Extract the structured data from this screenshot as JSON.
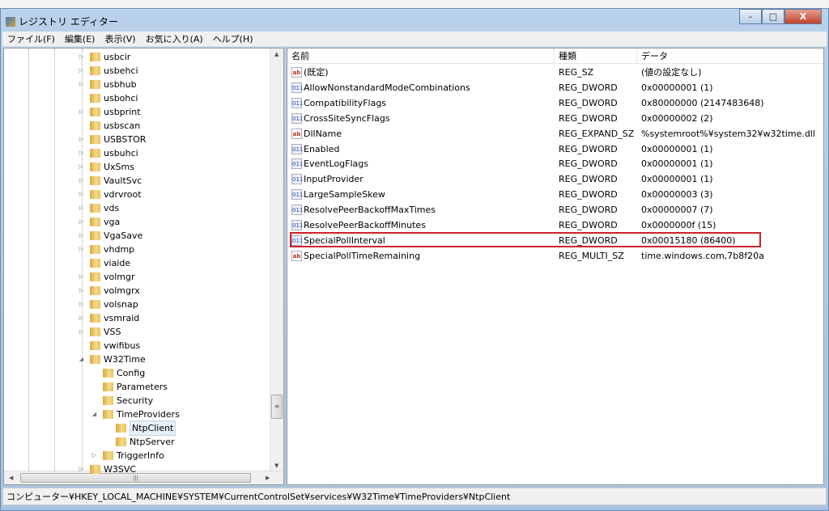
{
  "window": {
    "title": "レジストリ エディター",
    "minimize": "–",
    "maximize": "□",
    "close": "X"
  },
  "menu": [
    "ファイル(F)",
    "編集(E)",
    "表示(V)",
    "お気に入り(A)",
    "ヘルプ(H)"
  ],
  "tree": [
    {
      "label": "usbcir",
      "level": 0,
      "exp": "▷"
    },
    {
      "label": "usbehci",
      "level": 0,
      "exp": "▷"
    },
    {
      "label": "usbhub",
      "level": 0,
      "exp": "▷"
    },
    {
      "label": "usbohci",
      "level": 0,
      "exp": ""
    },
    {
      "label": "usbprint",
      "level": 0,
      "exp": "▷"
    },
    {
      "label": "usbscan",
      "level": 0,
      "exp": ""
    },
    {
      "label": "USBSTOR",
      "level": 0,
      "exp": "▷"
    },
    {
      "label": "usbuhci",
      "level": 0,
      "exp": "▷"
    },
    {
      "label": "UxSms",
      "level": 0,
      "exp": "▷"
    },
    {
      "label": "VaultSvc",
      "level": 0,
      "exp": "▷"
    },
    {
      "label": "vdrvroot",
      "level": 0,
      "exp": "▷"
    },
    {
      "label": "vds",
      "level": 0,
      "exp": "▷"
    },
    {
      "label": "vga",
      "level": 0,
      "exp": "▷"
    },
    {
      "label": "VgaSave",
      "level": 0,
      "exp": "▷"
    },
    {
      "label": "vhdmp",
      "level": 0,
      "exp": "▷"
    },
    {
      "label": "viaide",
      "level": 0,
      "exp": ""
    },
    {
      "label": "volmgr",
      "level": 0,
      "exp": "▷"
    },
    {
      "label": "volmgrx",
      "level": 0,
      "exp": "▷"
    },
    {
      "label": "volsnap",
      "level": 0,
      "exp": "▷"
    },
    {
      "label": "vsmraid",
      "level": 0,
      "exp": "▷"
    },
    {
      "label": "VSS",
      "level": 0,
      "exp": "▷"
    },
    {
      "label": "vwifibus",
      "level": 0,
      "exp": ""
    },
    {
      "label": "W32Time",
      "level": 0,
      "exp": "◢"
    },
    {
      "label": "Config",
      "level": 1,
      "exp": ""
    },
    {
      "label": "Parameters",
      "level": 1,
      "exp": ""
    },
    {
      "label": "Security",
      "level": 1,
      "exp": ""
    },
    {
      "label": "TimeProviders",
      "level": 1,
      "exp": "◢"
    },
    {
      "label": "NtpClient",
      "level": 2,
      "exp": "",
      "selected": true
    },
    {
      "label": "NtpServer",
      "level": 2,
      "exp": ""
    },
    {
      "label": "TriggerInfo",
      "level": 1,
      "exp": "▷"
    },
    {
      "label": "W3SVC",
      "level": 0,
      "exp": "▷"
    }
  ],
  "list": {
    "headers": [
      "名前",
      "種類",
      "データ"
    ],
    "rows": [
      {
        "icon": "string-value-icon",
        "name": "(既定)",
        "type": "REG_SZ",
        "data": "(値の設定なし)"
      },
      {
        "icon": "binary-value-icon",
        "name": "AllowNonstandardModeCombinations",
        "type": "REG_DWORD",
        "data": "0x00000001 (1)"
      },
      {
        "icon": "binary-value-icon",
        "name": "CompatibilityFlags",
        "type": "REG_DWORD",
        "data": "0x80000000 (2147483648)"
      },
      {
        "icon": "binary-value-icon",
        "name": "CrossSiteSyncFlags",
        "type": "REG_DWORD",
        "data": "0x00000002 (2)"
      },
      {
        "icon": "string-value-icon",
        "name": "DllName",
        "type": "REG_EXPAND_SZ",
        "data": "%systemroot%¥system32¥w32time.dll"
      },
      {
        "icon": "binary-value-icon",
        "name": "Enabled",
        "type": "REG_DWORD",
        "data": "0x00000001 (1)"
      },
      {
        "icon": "binary-value-icon",
        "name": "EventLogFlags",
        "type": "REG_DWORD",
        "data": "0x00000001 (1)"
      },
      {
        "icon": "binary-value-icon",
        "name": "InputProvider",
        "type": "REG_DWORD",
        "data": "0x00000001 (1)"
      },
      {
        "icon": "binary-value-icon",
        "name": "LargeSampleSkew",
        "type": "REG_DWORD",
        "data": "0x00000003 (3)"
      },
      {
        "icon": "binary-value-icon",
        "name": "ResolvePeerBackoffMaxTimes",
        "type": "REG_DWORD",
        "data": "0x00000007 (7)"
      },
      {
        "icon": "binary-value-icon",
        "name": "ResolvePeerBackoffMinutes",
        "type": "REG_DWORD",
        "data": "0x0000000f (15)"
      },
      {
        "icon": "binary-value-icon",
        "name": "SpecialPollInterval",
        "type": "REG_DWORD",
        "data": "0x00015180 (86400)",
        "highlighted": true
      },
      {
        "icon": "string-value-icon",
        "name": "SpecialPollTimeRemaining",
        "type": "REG_MULTI_SZ",
        "data": "time.windows.com,7b8f20a"
      }
    ]
  },
  "status": "コンピューター¥HKEY_LOCAL_MACHINE¥SYSTEM¥CurrentControlSet¥services¥W32Time¥TimeProviders¥NtpClient",
  "colors": {
    "highlight": "#d0202a"
  }
}
